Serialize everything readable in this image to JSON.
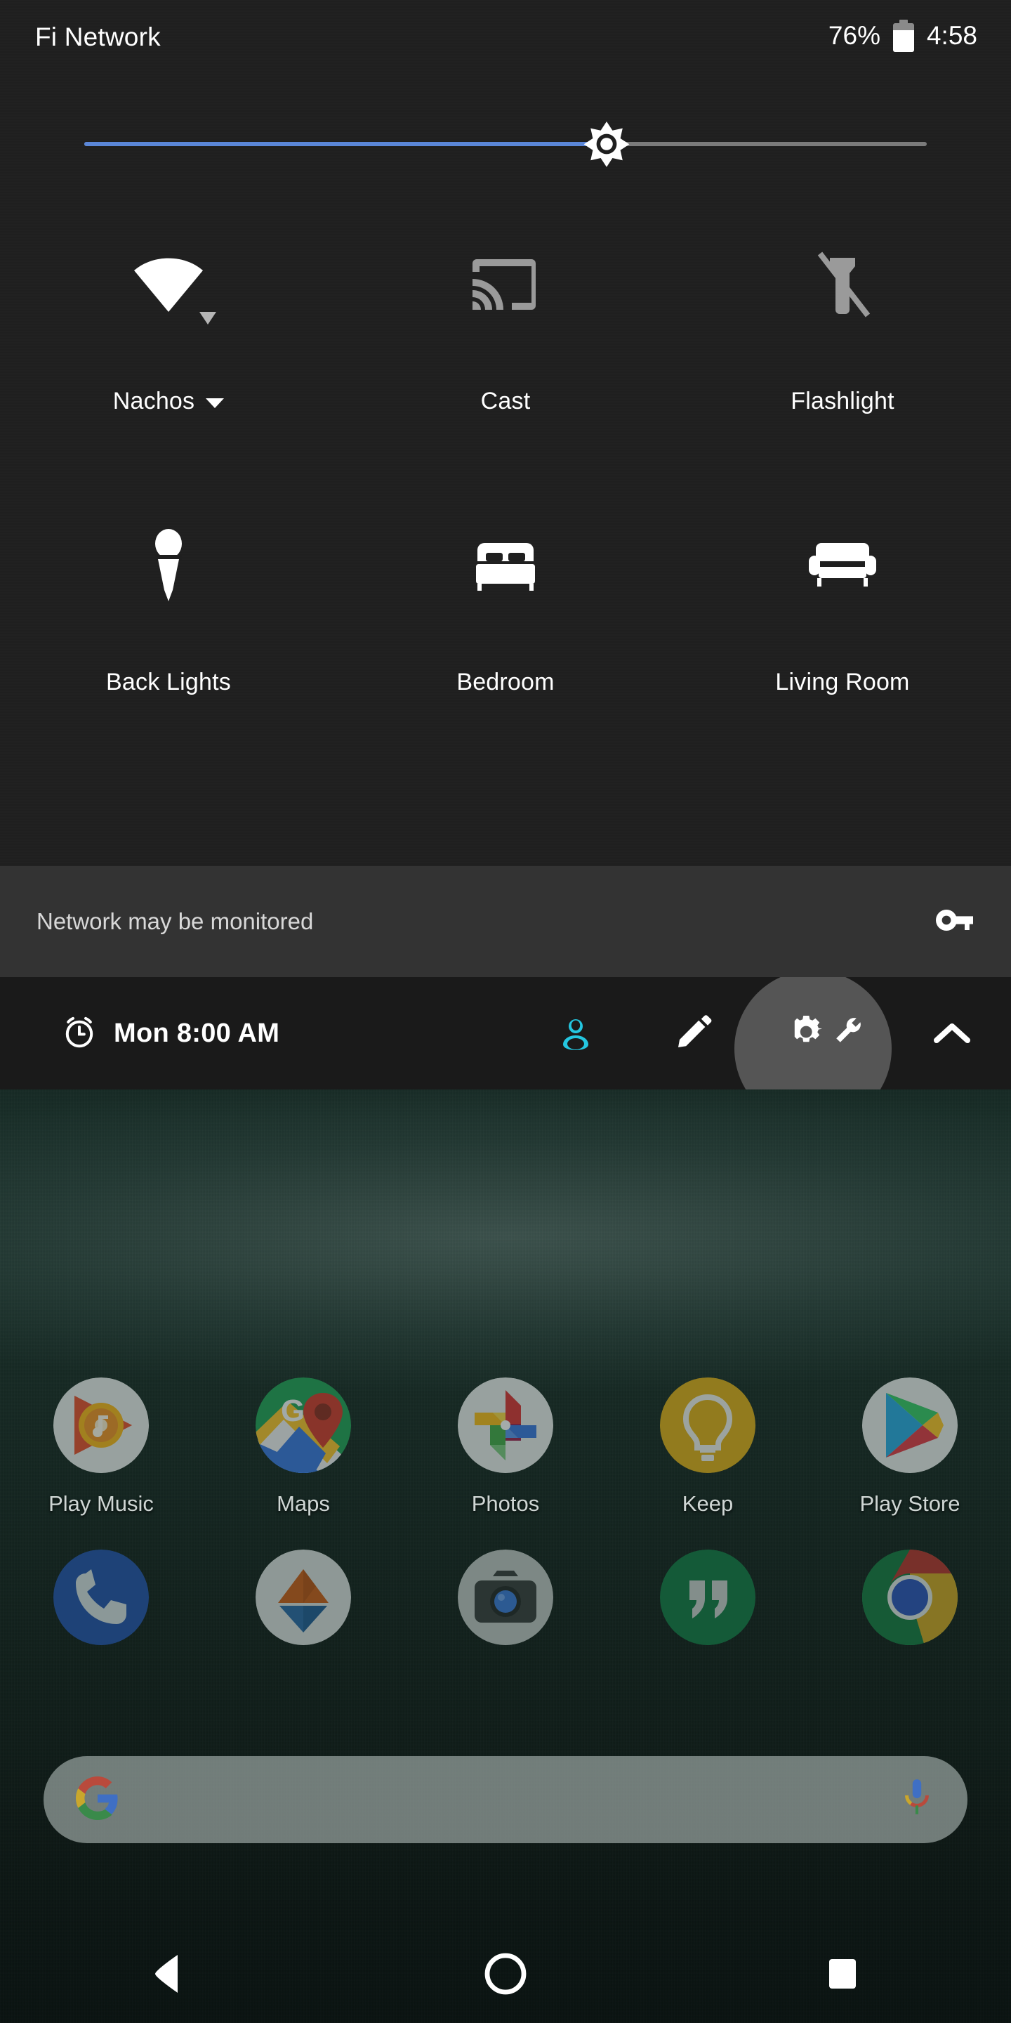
{
  "status_bar": {
    "carrier": "Fi Network",
    "battery_percent": "76%",
    "battery_level": 76,
    "clock": "4:58",
    "battery_icon": "battery-icon"
  },
  "brightness": {
    "value_percent": 62,
    "thumb_icon": "brightness-sun-icon",
    "fill_color": "#5b87d8",
    "track_color": "#7b7b7b"
  },
  "quick_settings": {
    "tiles": [
      {
        "label": "Nachos",
        "icon": "wifi-icon",
        "state": "on",
        "has_chevron": true,
        "has_sub_arrow": true
      },
      {
        "label": "Cast",
        "icon": "cast-icon",
        "state": "off",
        "has_chevron": false,
        "has_sub_arrow": false
      },
      {
        "label": "Flashlight",
        "icon": "flashlight-off-icon",
        "state": "off",
        "has_chevron": false,
        "has_sub_arrow": false
      },
      {
        "label": "Back Lights",
        "icon": "spotlight-icon",
        "state": "on",
        "has_chevron": false,
        "has_sub_arrow": false
      },
      {
        "label": "Bedroom",
        "icon": "bed-icon",
        "state": "on",
        "has_chevron": false,
        "has_sub_arrow": false
      },
      {
        "label": "Living Room",
        "icon": "sofa-icon",
        "state": "on",
        "has_chevron": false,
        "has_sub_arrow": false
      }
    ]
  },
  "monitored_banner": {
    "text": "Network may be monitored",
    "icon": "key-icon"
  },
  "qs_footer": {
    "alarm_icon": "alarm-clock-icon",
    "alarm_text": "Mon 8:00 AM",
    "actions": [
      {
        "name": "user-avatar",
        "icon": "user-icon",
        "color": "#24c6e0",
        "highlighted": false
      },
      {
        "name": "edit-tiles",
        "icon": "pencil-icon",
        "color": "#ffffff",
        "highlighted": false
      },
      {
        "name": "system-ui-tuner",
        "icon": "gear-wrench-icon",
        "color": "#ffffff",
        "highlighted": true
      },
      {
        "name": "collapse-panel",
        "icon": "chevron-up-icon",
        "color": "#ffffff",
        "highlighted": false
      }
    ]
  },
  "home_screen": {
    "row1": [
      {
        "label": "Play Music",
        "icon": "play-music-icon"
      },
      {
        "label": "Maps",
        "icon": "maps-icon"
      },
      {
        "label": "Photos",
        "icon": "photos-icon"
      },
      {
        "label": "Keep",
        "icon": "keep-icon"
      },
      {
        "label": "Play Store",
        "icon": "play-store-icon"
      }
    ],
    "row2": [
      {
        "label": "",
        "icon": "phone-icon"
      },
      {
        "label": "",
        "icon": "android-auto-icon"
      },
      {
        "label": "",
        "icon": "camera-icon"
      },
      {
        "label": "",
        "icon": "hangouts-icon"
      },
      {
        "label": "",
        "icon": "chrome-icon"
      }
    ],
    "search": {
      "value": "",
      "placeholder": "",
      "left_icon": "google-g-icon",
      "right_icon": "microphone-icon"
    }
  },
  "nav_bar": {
    "buttons": [
      {
        "name": "back-button",
        "icon": "back-triangle-icon"
      },
      {
        "name": "home-button",
        "icon": "home-circle-icon"
      },
      {
        "name": "recents-button",
        "icon": "recents-square-icon"
      }
    ]
  },
  "colors": {
    "qs_background": "#1f1f1f",
    "banner_background": "#333333",
    "footer_background": "#1a1a1a",
    "accent_blue": "#5b87d8",
    "avatar_cyan": "#24c6e0",
    "tile_off_gray": "#9a9a9a"
  }
}
